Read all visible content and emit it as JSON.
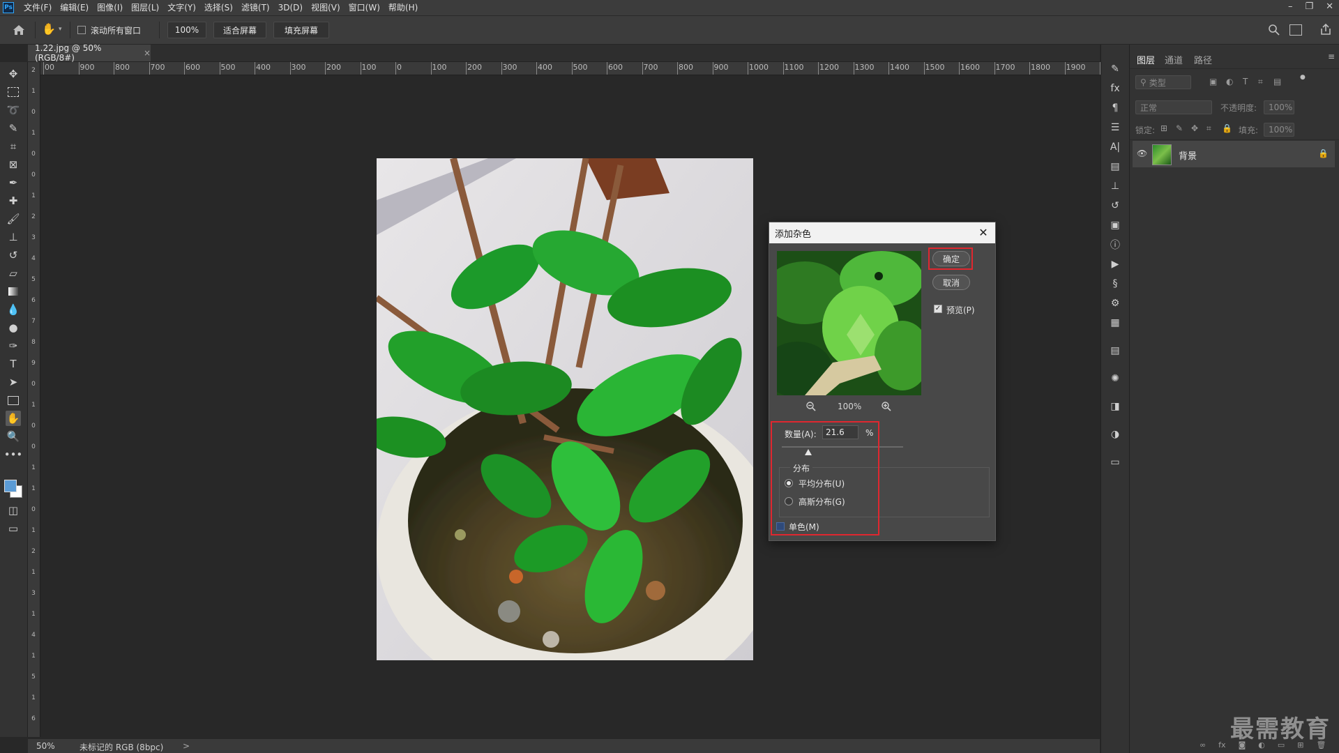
{
  "app": {
    "logo": "Ps"
  },
  "menu": [
    "文件(F)",
    "编辑(E)",
    "图像(I)",
    "图层(L)",
    "文字(Y)",
    "选择(S)",
    "滤镜(T)",
    "3D(D)",
    "视图(V)",
    "窗口(W)",
    "帮助(H)"
  ],
  "window_controls": {
    "minimize": "–",
    "restore": "❐",
    "close": "✕"
  },
  "options_bar": {
    "scroll_all_label": "滚动所有窗口",
    "zoom_value": "100%",
    "fit_screen": "适合屏幕",
    "fill_screen": "填充屏幕"
  },
  "document_tab": {
    "title": "1.22.jpg @ 50%(RGB/8#)",
    "close": "×"
  },
  "ruler": {
    "top_labels": [
      "00",
      "900",
      "800",
      "700",
      "600",
      "500",
      "400",
      "300",
      "200",
      "100",
      "0",
      "100",
      "200",
      "300",
      "400",
      "500",
      "600",
      "700",
      "800",
      "900",
      "1000",
      "1100",
      "1200",
      "1300",
      "1400",
      "1500",
      "1600",
      "1700",
      "1800",
      "1900",
      "200"
    ],
    "left_labels": [
      "2",
      "1",
      "0",
      "1",
      "0",
      "0",
      "1",
      "2",
      "3",
      "4",
      "5",
      "6",
      "7",
      "8",
      "9",
      "0",
      "1",
      "0",
      "0",
      "1",
      "1",
      "0",
      "1",
      "2",
      "1",
      "3",
      "1",
      "4",
      "1",
      "5",
      "1",
      "6"
    ]
  },
  "status_bar": {
    "zoom": "50%",
    "profile": "未标记的 RGB (8bpc)",
    "arrow": ">"
  },
  "dialog": {
    "title": "添加杂色",
    "close": "✕",
    "ok": "确定",
    "cancel": "取消",
    "preview_label": "预览(P)",
    "preview_checked": true,
    "zoom_level": "100%",
    "amount_label": "数量(A):",
    "amount_value": "21.6",
    "amount_unit": "%",
    "amount_slider": 0.22,
    "distribution_title": "分布",
    "uniform_label": "平均分布(U)",
    "gaussian_label": "高斯分布(G)",
    "uniform_selected": true,
    "mono_label": "单色(M)",
    "mono_checked": false
  },
  "layers_panel": {
    "tabs": [
      "图层",
      "通道",
      "路径"
    ],
    "filter_placeholder": "类型",
    "blend_mode": "正常",
    "opacity_label": "不透明度:",
    "opacity_value": "100%",
    "lock_label": "锁定:",
    "fill_label": "填充:",
    "fill_value": "100%",
    "layer_name": "背景"
  },
  "watermark": "最需教育",
  "colors": {
    "accent_red": "#e0272f",
    "panel_bg": "#333333",
    "canvas_bg": "#282828",
    "foreground": "#5b9bd5",
    "background": "#ffffff"
  }
}
